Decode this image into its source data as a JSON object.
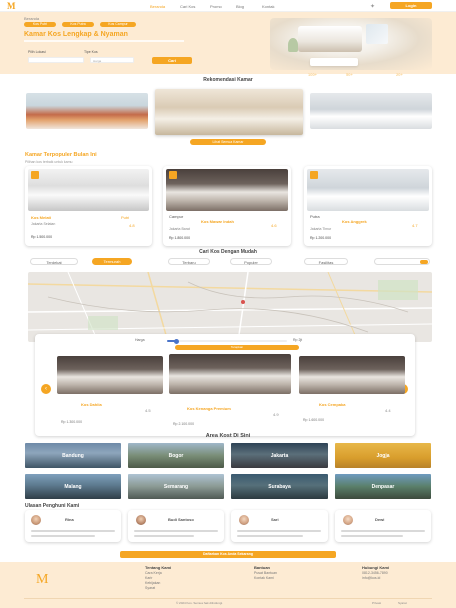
{
  "nav": {
    "brand": "M",
    "links": [
      "Beranda",
      "Cari Kos",
      "Promo",
      "Blog",
      "Kontak",
      "Login"
    ]
  },
  "hero": {
    "breadcrumb": "Beranda",
    "tags": [
      "Kos Putri",
      "Kos Putra",
      "Kos Campur"
    ],
    "title": "Kamar Kos Lengkap & Nyaman",
    "input_location": "Pilih Lokasi",
    "input_type": "Tipe Kos",
    "input_price": "Harga",
    "search_button": "Cari"
  },
  "gallery": {
    "heading": "Rekomendasi Kamar",
    "pager": "Lihat Semua Kamar",
    "stats": [
      "100+",
      "50+",
      "20+"
    ]
  },
  "listings": {
    "heading": "Kamar Terpopuler Bulan Ini",
    "subheading": "Pilihan kos terbaik untuk kamu",
    "items": [
      {
        "tag": "Putri",
        "name": "Kos Melati",
        "location": "Jakarta Selatan",
        "price": "Rp 1.500.000",
        "rating": "4.8"
      },
      {
        "tag": "Campur",
        "name": "Kos Mawar Indah",
        "location": "Jakarta Barat",
        "price": "Rp 1.800.000",
        "rating": "4.6"
      },
      {
        "tag": "Putra",
        "name": "Kos Anggrek",
        "location": "Jakarta Timur",
        "price": "Rp 1.200.000",
        "rating": "4.7"
      }
    ]
  },
  "filters": {
    "heading": "Cari Kos Dengan Mudah",
    "chips": [
      "Terdekat",
      "Termurah",
      "Terbaru",
      "Populer",
      "Fasilitas"
    ]
  },
  "map": {
    "range_label_left": "Harga",
    "range_label_right": "Rp 2jt",
    "range_percent": 0.08,
    "cta": "Terapkan",
    "cards": [
      {
        "name": "Kos Dahlia",
        "price": "Rp 1.300.000",
        "rating": "4.5"
      },
      {
        "name": "Kos Kenanga Premium",
        "price": "Rp 2.100.000",
        "rating": "4.9"
      },
      {
        "name": "Kos Cempaka",
        "price": "Rp 1.600.000",
        "rating": "4.4"
      }
    ]
  },
  "areas": {
    "heading": "Area Kost Di Sini",
    "items": [
      "Bandung",
      "Bogor",
      "Jakarta",
      "Jogja",
      "Malang",
      "Semarang",
      "Surabaya",
      "Denpasar"
    ]
  },
  "testimonials": {
    "heading": "Ulasan Penghuni Kami",
    "people": [
      {
        "name": "Rina"
      },
      {
        "name": "Budi Santoso"
      },
      {
        "name": "Sari"
      },
      {
        "name": "Dewi"
      }
    ]
  },
  "footer": {
    "cta": "Daftarkan Kos Anda Sekarang",
    "brand": "M",
    "col1": {
      "title": "Tentang Kami",
      "items": [
        "Cara Kerja",
        "Karir",
        "Kebijakan",
        "Syarat"
      ]
    },
    "col2": {
      "title": "Bantuan",
      "items": [
        "Pusat Bantuan",
        "Kontak Kami"
      ]
    },
    "col3": {
      "title": "Hubungi Kami",
      "items": [
        "0812-3456-7890",
        "info@kos.id"
      ]
    },
    "copyright": "© 2024 Kos. Semua hak dilindungi.",
    "bottom_links": [
      "Privasi",
      "Syarat"
    ]
  }
}
